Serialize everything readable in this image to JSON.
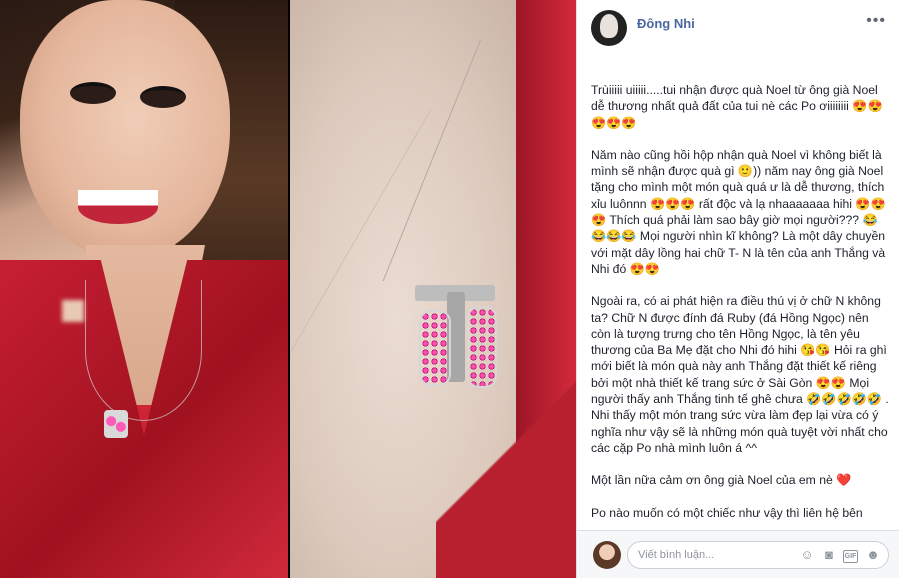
{
  "post": {
    "author": "Đông Nhi",
    "more_icon": "more-dots-icon",
    "paragraphs": [
      "Trùiiiii uiiiii.....tui nhận được quà Noel từ ông già Noel dễ thương nhất quả đất của tui nè các Po ơiiiiiiii 😍😍😍😍😍",
      "Năm nào cũng hồi hộp nhận quà Noel vì không biết là mình sẽ nhận được quà gì 🙂)) năm nay ông già Noel tặng cho mình một món quà quá ư là dễ thương, thích xỉu luônnn 😍😍😍 rất độc và lạ nhaaaaaaa hihi 😍😍😍 Thích quá phải làm sao bây giờ mọi người??? 😂😂😂😂 Mọi người nhìn kĩ không? Là một dây chuyền với mặt dây lồng hai chữ T- N là tên của anh Thắng và Nhi đó 😍😍",
      "Ngoài ra, có ai phát hiện ra điều thú vị ở chữ N không ta? Chữ N được đính đá Ruby (đá Hồng Ngọc) nên còn là tượng trưng cho tên Hồng Ngọc, là tên yêu thương của Ba Mẹ đặt cho Nhi đó hihi 😘😘 Hỏi ra ghì mới biết là món quà này anh Thắng đặt thiết kế riêng bởi một nhà thiết kế trang sức ở Sài Gòn 😍😍 Mọi người thấy anh Thắng tinh tế ghê chưa 🤣🤣🤣🤣🤣 . Nhi thấy một món trang sức vừa làm đẹp lại vừa có ý nghĩa như vậy sẽ là những món quà tuyệt vời nhất cho các cặp Po nhà mình luôn á ^^",
      "Một lần nữa cảm ơn ông già Noel của em nè ❤️",
      "Po nào muốn có một chiếc như vậy thì liên hệ bên"
    ]
  },
  "comment": {
    "placeholder": "Viết bình luận...",
    "icons": [
      "smile-icon",
      "camera-icon",
      "gif-icon",
      "sticker-icon"
    ],
    "gif_label": "GIF"
  }
}
